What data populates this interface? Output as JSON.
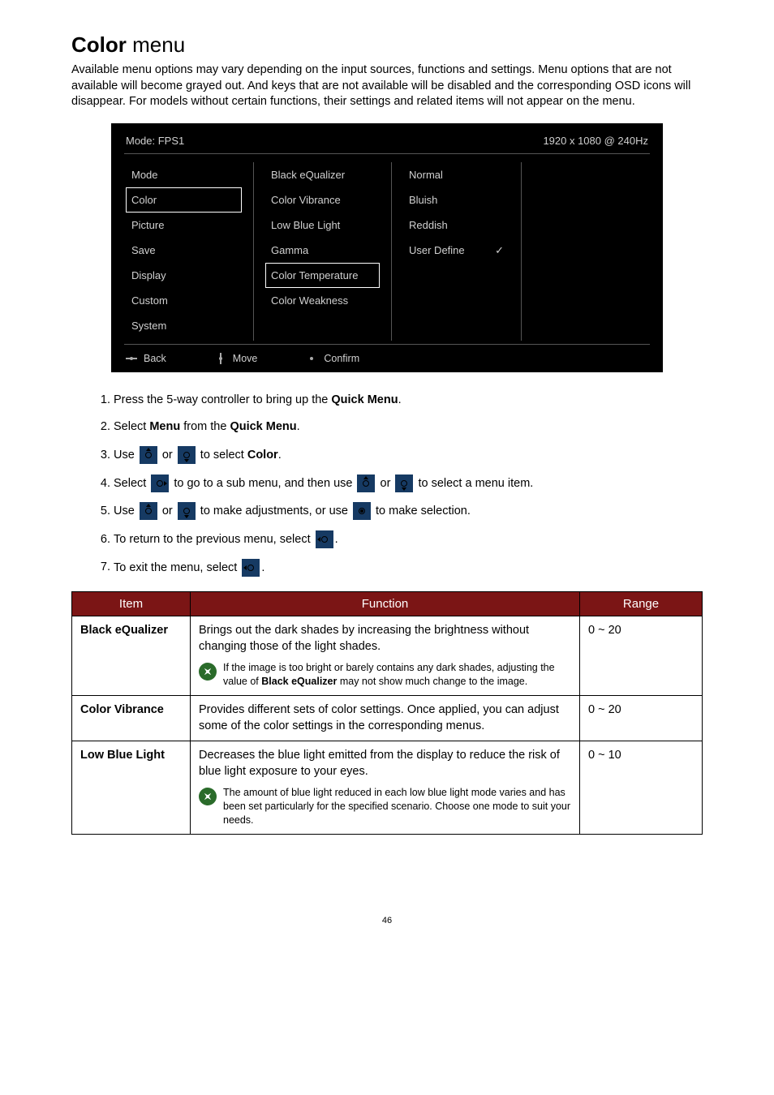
{
  "title_bold": "Color",
  "title_rest": " menu",
  "intro": "Available menu options may vary depending on the input sources, functions and settings. Menu options that are not available will become grayed out. And keys that are not available will be disabled and the corresponding OSD icons will disappear. For models without certain functions, their settings and related items will not appear on the menu.",
  "osd": {
    "mode_label": "Mode: FPS1",
    "resolution": "1920 x 1080 @ 240Hz",
    "col1": [
      "Mode",
      "Color",
      "Picture",
      "Save",
      "Display",
      "Custom",
      "System"
    ],
    "col2": [
      "Black eQualizer",
      "Color Vibrance",
      "Low Blue Light",
      "Gamma",
      "Color Temperature",
      "Color Weakness"
    ],
    "col3": [
      "Normal",
      "Bluish",
      "Reddish",
      "User Define"
    ],
    "col1_selected_index": 1,
    "col2_selected_index": 4,
    "col3_checked_index": 3,
    "foot_back": "Back",
    "foot_move": "Move",
    "foot_confirm": "Confirm"
  },
  "steps": {
    "s1a": "Press the 5-way controller to bring up the ",
    "s1b": "Quick Menu",
    "s2a": "Select ",
    "s2b": "Menu",
    "s2c": " from the ",
    "s2d": "Quick Menu",
    "s3a": "Use ",
    "s3b": " or ",
    "s3c": " to select ",
    "s3d": "Color",
    "s4a": "Select ",
    "s4b": " to go to a sub menu, and then use ",
    "s4c": " or ",
    "s4d": " to select a menu item.",
    "s5a": "Use ",
    "s5b": " or ",
    "s5c": " to make adjustments, or use ",
    "s5d": " to make selection.",
    "s6a": "To return to the previous menu, select ",
    "s7a": "To exit the menu, select "
  },
  "table": {
    "h1": "Item",
    "h2": "Function",
    "h3": "Range",
    "rows": [
      {
        "name": "Black eQualizer",
        "func": "Brings out the dark shades by increasing the brightness without changing those of the light shades.",
        "note_a": "If the image is too bright or barely contains any dark shades, adjusting the value of ",
        "note_b": "Black eQualizer",
        "note_c": " may not show much change to the image.",
        "range": "0 ~ 20"
      },
      {
        "name": "Color Vibrance",
        "func": "Provides different sets of color settings. Once applied, you can adjust some of the color settings in the corresponding menus.",
        "range": "0 ~ 20"
      },
      {
        "name": "Low Blue Light",
        "func": "Decreases the blue light emitted from the display to reduce the risk of blue light exposure to your eyes.",
        "note_a": "The amount of blue light reduced in each low blue light mode varies and has been set particularly for the specified scenario. Choose one mode to suit your needs.",
        "range": "0 ~ 10"
      }
    ]
  },
  "page_number": "46"
}
